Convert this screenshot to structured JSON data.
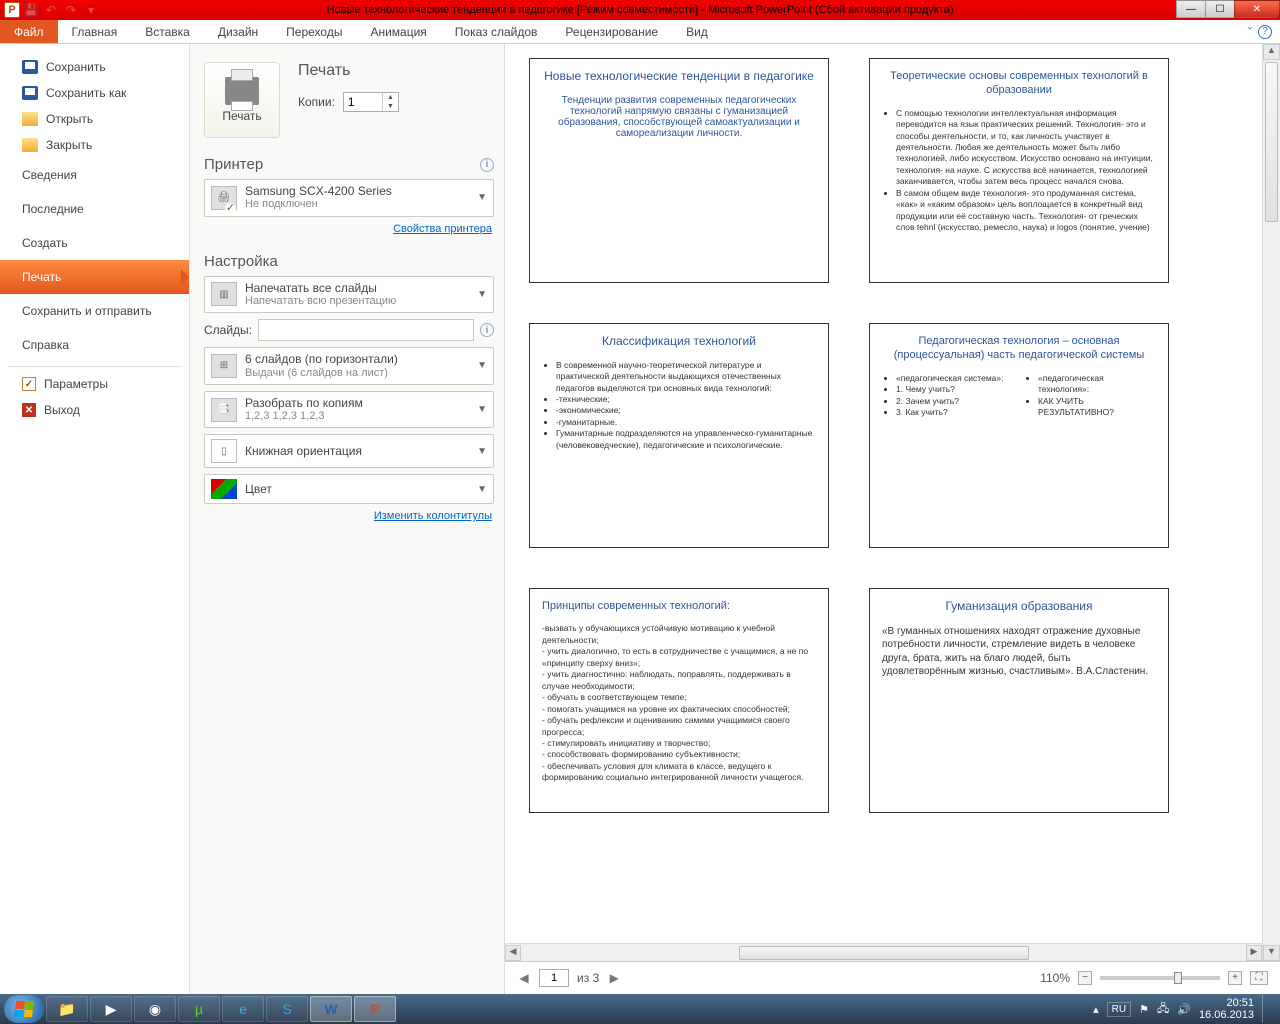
{
  "title": "Новые технологические тенденции в педагогике [Режим совместимости]  -  Microsoft PowerPoint (Сбой активации продукта)",
  "ribbon": {
    "file": "Файл",
    "tabs": [
      "Главная",
      "Вставка",
      "Дизайн",
      "Переходы",
      "Анимация",
      "Показ слайдов",
      "Рецензирование",
      "Вид"
    ]
  },
  "backstage_left": {
    "save": "Сохранить",
    "save_as": "Сохранить как",
    "open": "Открыть",
    "close": "Закрыть",
    "info": "Сведения",
    "recent": "Последние",
    "new": "Создать",
    "print": "Печать",
    "share": "Сохранить и отправить",
    "help": "Справка",
    "options": "Параметры",
    "exit": "Выход"
  },
  "print": {
    "heading": "Печать",
    "print_btn": "Печать",
    "copies_label": "Копии:",
    "copies_value": "1",
    "printer_head": "Принтер",
    "printer_name": "Samsung SCX-4200 Series",
    "printer_status": "Не подключен",
    "printer_props": "Свойства принтера",
    "settings_head": "Настройка",
    "all_slides": "Напечатать все слайды",
    "all_slides_sub": "Напечатать всю презентацию",
    "slides_label": "Слайды:",
    "layout": "6 слайдов (по горизонтали)",
    "layout_sub": "Выдачи (6 слайдов на лист)",
    "collate": "Разобрать по копиям",
    "collate_sub": "1,2,3   1,2,3   1,2,3",
    "orientation": "Книжная ориентация",
    "color": "Цвет",
    "headers_footers": "Изменить колонтитулы"
  },
  "preview": {
    "slides": [
      {
        "title": "Новые технологические тенденции  в педагогике",
        "body": "Тенденции развития современных педагогических технологий напрямую связаны с гуманизацией образования, способствующей самоактуализации и самореализации личности."
      },
      {
        "title": "Теоретические  основы современных технологий  в образовании",
        "pts": [
          "С помощью технологии интеллектуальная информация переводится на язык практических решений. Технология- это и способы деятельности, и то, как личность участвует в деятельности. Любая же деятельность может быть либо технологией, либо искусством. Искусство основано на интуиции, технология- на науке. С искусства всё начинается, технологией заканчивается, чтобы затем весь процесс начался снова.",
          "В самом общем виде технология- это продуманная система, «как» и «каким образом» цель воплощается в конкретный вид продукции или её составную часть. Технология- от греческих слов tehnl (искусство, ремесло, наука) и logos (понятие, учение)"
        ]
      },
      {
        "title": "Классификация технологий",
        "pts": [
          "В современной научно-теоретической литературе и практической деятельности выдающихся отечественных педагогов выделяются три основных вида технологий:",
          "-технические;",
          "-экономические;",
          "-гуманитарные.",
          "Гуманитарные подразделяются на управленческо-гуманитарные (человековедческие), педагогические и психологические."
        ]
      },
      {
        "title": "Педагогическая технология – основная (процессуальная) часть педагогической системы",
        "left": [
          "«педагогическая система»:",
          "1. Чему учить?",
          "2. Зачем учить?",
          "3. Как учить?"
        ],
        "right": [
          "«педагогическая технология»:",
          "КАК УЧИТЬ РЕЗУЛЬТАТИВНО?"
        ]
      },
      {
        "title": "Принципы современных технологий:",
        "pts": [
          "-вызвать у обучающихся устойчивую мотивацию к учебной деятельности;",
          "- учить диалогично, то есть в сотрудничестве с учащимися, а не по «принципу сверху вниз»;",
          "- учить диагностично: наблюдать, поправлять, поддерживать в случае необходимости;",
          "- обучать в соответствующем темпе;",
          "- помогать учащимся на уровне их фактических способностей;",
          "- обучать рефлексии и оцениванию самими учащимися своего прогресса;",
          "- стимулировать инициативу и творчество;",
          "- способствовать формированию субъективности;",
          "- обеспечивать условия для климата в классе, ведущего к формированию социально интегрированной личности учащегося."
        ]
      },
      {
        "title": "Гуманизация образования",
        "body": "«В гуманных отношениях находят отражение духовные потребности личности, стремление видеть в человеке друга, брата, жить на благо людей, быть удовлетворённым жизнью, счастливым». В.А.Сластенин."
      }
    ],
    "page_current": "1",
    "page_of": "из 3",
    "zoom": "110%"
  },
  "taskbar": {
    "lang": "RU",
    "time": "20:51",
    "date": "16.06.2013"
  }
}
